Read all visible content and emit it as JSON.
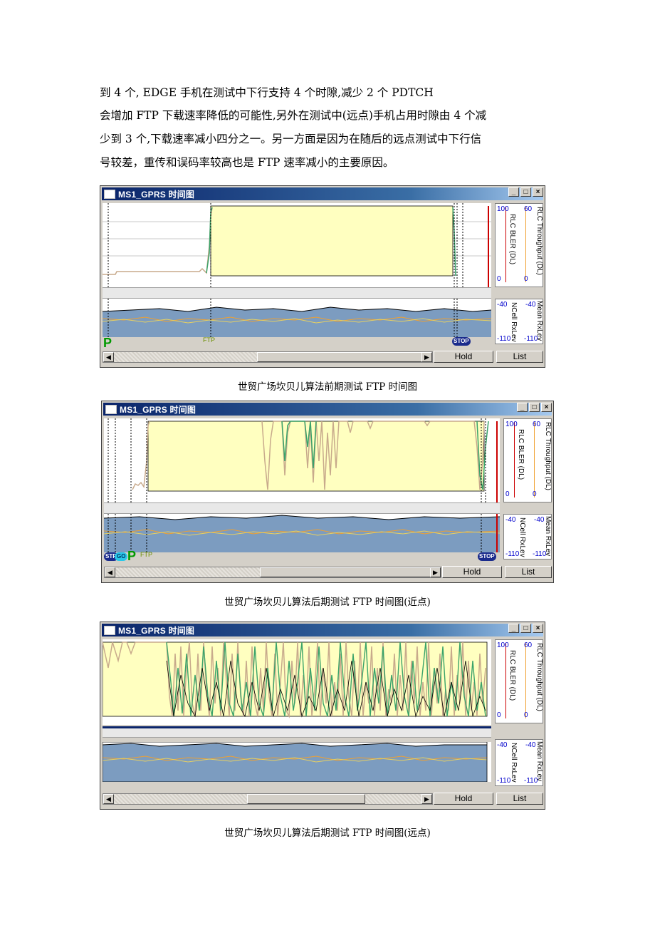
{
  "paragraph": {
    "lines": [
      "到 4 个, EDGE 手机在测试中下行支持 4 个时隙,减少 2 个 PDTCH",
      "会增加 FTP 下载速率降低的可能性,另外在测试中(远点)手机占用时隙由 4 个减",
      "少到 3 个,下载速率减小四分之一。另一方面是因为在随后的远点测试中下行信",
      "号较差，重传和误码率较高也是 FTP 速率减小的主要原因。"
    ]
  },
  "windows": [
    {
      "title": "MS1_GPRS 时间图",
      "caption": "世贸广场坎贝儿算法前期测试 FTP 时间图",
      "axis_top": {
        "left_max": "100",
        "right_max": "60",
        "left_min": "0",
        "right_min": "0",
        "label": "RLC BLER (DL)",
        "label2": "RLC Throughput (DL)"
      },
      "axis_bottom": {
        "left_max": "-40",
        "right_max": "-40",
        "left_min": "-110",
        "right_min": "-110",
        "label": "NCell RxLev",
        "label2": "Mean RxLev"
      },
      "hold_label": "Hold",
      "list_label": "List",
      "markers": {
        "p": "P",
        "ftp": "FTP",
        "stop": "STOP"
      }
    },
    {
      "title": "MS1_GPRS 时间图",
      "caption": "世贸广场坎贝儿算法后期测试 FTP 时间图(近点)",
      "axis_top": {
        "left_max": "100",
        "right_max": "60",
        "left_min": "0",
        "right_min": "0",
        "label": "RLC BLER (DL)",
        "label2": "RLC Throughput (DL)"
      },
      "axis_bottom": {
        "left_max": "-40",
        "right_max": "-40",
        "left_min": "-110",
        "right_min": "-110",
        "label": "NCell RxLev",
        "label2": "Mean RxLev"
      },
      "hold_label": "Hold",
      "list_label": "List",
      "markers": {
        "p": "P",
        "ftp": "FTP",
        "stop": "STOP",
        "stp": "STP",
        "go": "GO"
      }
    },
    {
      "title": "MS1_GPRS 时间图",
      "caption": "世贸广场坎贝儿算法后期测试 FTP 时间图(远点)",
      "axis_top": {
        "left_max": "100",
        "right_max": "60",
        "left_min": "0",
        "right_min": "0",
        "label": "RLC BLER (DL)",
        "label2": "RLC Throughput (DL)"
      },
      "axis_bottom": {
        "left_max": "-40",
        "right_max": "-40",
        "left_min": "-110",
        "right_min": "-110",
        "label": "NCell RxLev",
        "label2": "Mean RxLev"
      },
      "hold_label": "Hold",
      "list_label": "List"
    }
  ],
  "colors": {
    "fill": "#ffffc0",
    "green": "#3aa36a",
    "tan": "#c8aa8c",
    "band": "#7c9cc0",
    "orange": "#f0a030",
    "red": "#cc0000"
  }
}
